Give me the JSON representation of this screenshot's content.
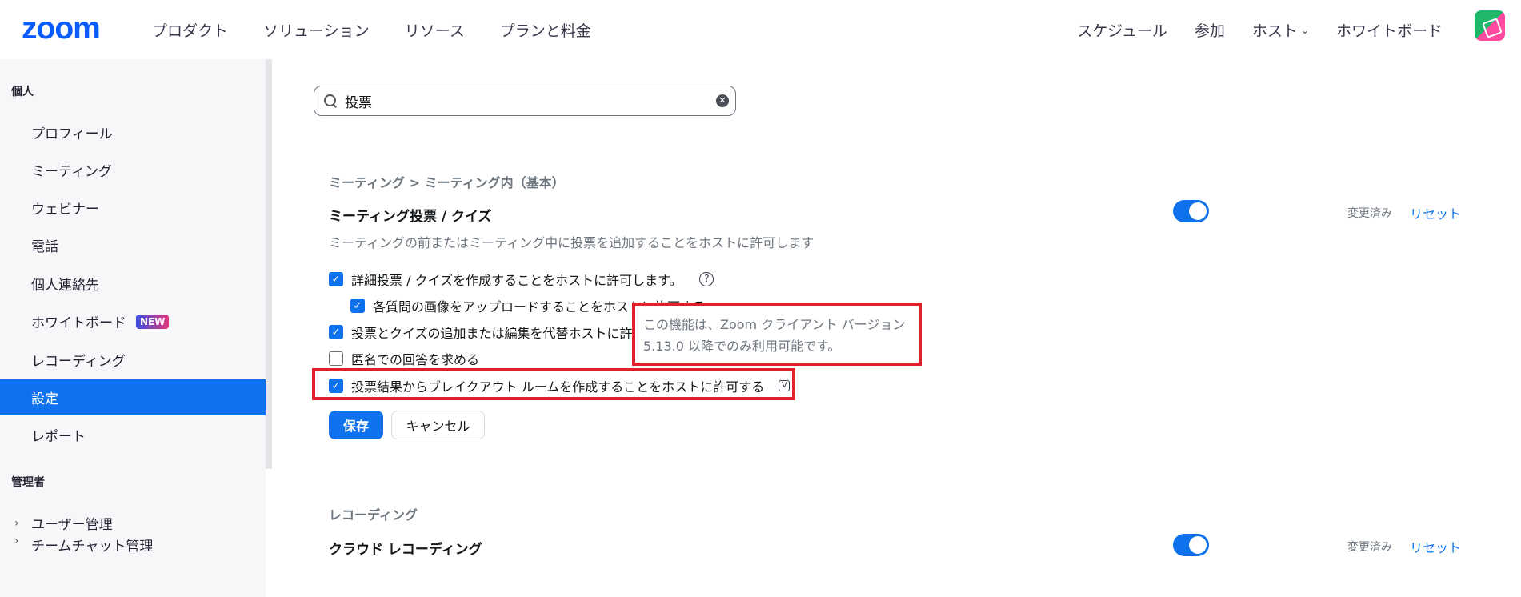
{
  "header": {
    "logo": "zoom",
    "nav_left": [
      "プロダクト",
      "ソリューション",
      "リソース",
      "プランと料金"
    ],
    "nav_right": [
      "スケジュール",
      "参加",
      "ホスト",
      "ホワイトボード"
    ]
  },
  "sidebar": {
    "personal_label": "個人",
    "items": [
      "プロフィール",
      "ミーティング",
      "ウェビナー",
      "電話",
      "個人連絡先",
      "ホワイトボード",
      "レコーディング",
      "設定",
      "レポート"
    ],
    "new_badge": "NEW",
    "admin_label": "管理者",
    "admin_items": [
      "ユーザー管理",
      "チームチャット管理"
    ]
  },
  "search": {
    "value": "投票"
  },
  "setting": {
    "breadcrumb": "ミーティング > ミーティング内（基本）",
    "title": "ミーティング投票 / クイズ",
    "description": "ミーティングの前またはミーティング中に投票を追加することをホストに許可します",
    "changed": "変更済み",
    "reset": "リセット",
    "options": [
      "詳細投票 / クイズを作成することをホストに許可します。",
      "各質問の画像をアップロードすることをホストに許可する",
      "投票とクイズの追加または編集を代替ホストに許可",
      "匿名での回答を求める",
      "投票結果からブレイクアウト ルームを作成することをホストに許可する"
    ],
    "tooltip": "この機能は、Zoom クライアント バージョン 5.13.0 以降でのみ利用可能です。",
    "save": "保存",
    "cancel": "キャンセル"
  },
  "recording": {
    "section": "レコーディング",
    "title": "クラウド レコーディング",
    "changed": "変更済み",
    "reset": "リセット"
  },
  "colors": {
    "accent": "#0e72ed",
    "highlight": "#e0202c"
  }
}
